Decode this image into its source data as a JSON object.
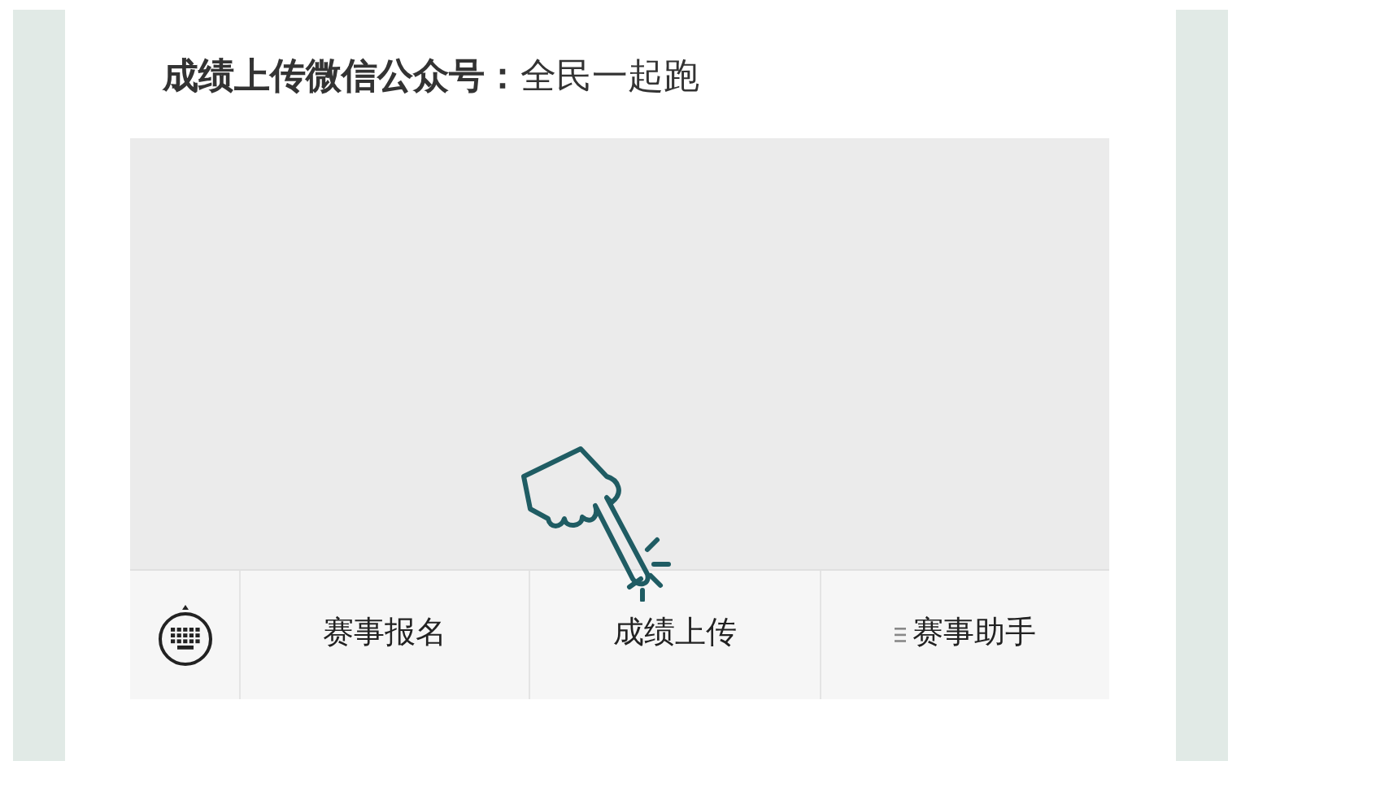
{
  "title": "**成绩上传微信公众号：**全民一起跑",
  "menu": [
    {
      "label": "赛事报名",
      "kind": "plain"
    },
    {
      "label": "成绩上传",
      "kind": "plain"
    },
    {
      "label": "赛事助手",
      "kind": "submenu"
    }
  ]
}
